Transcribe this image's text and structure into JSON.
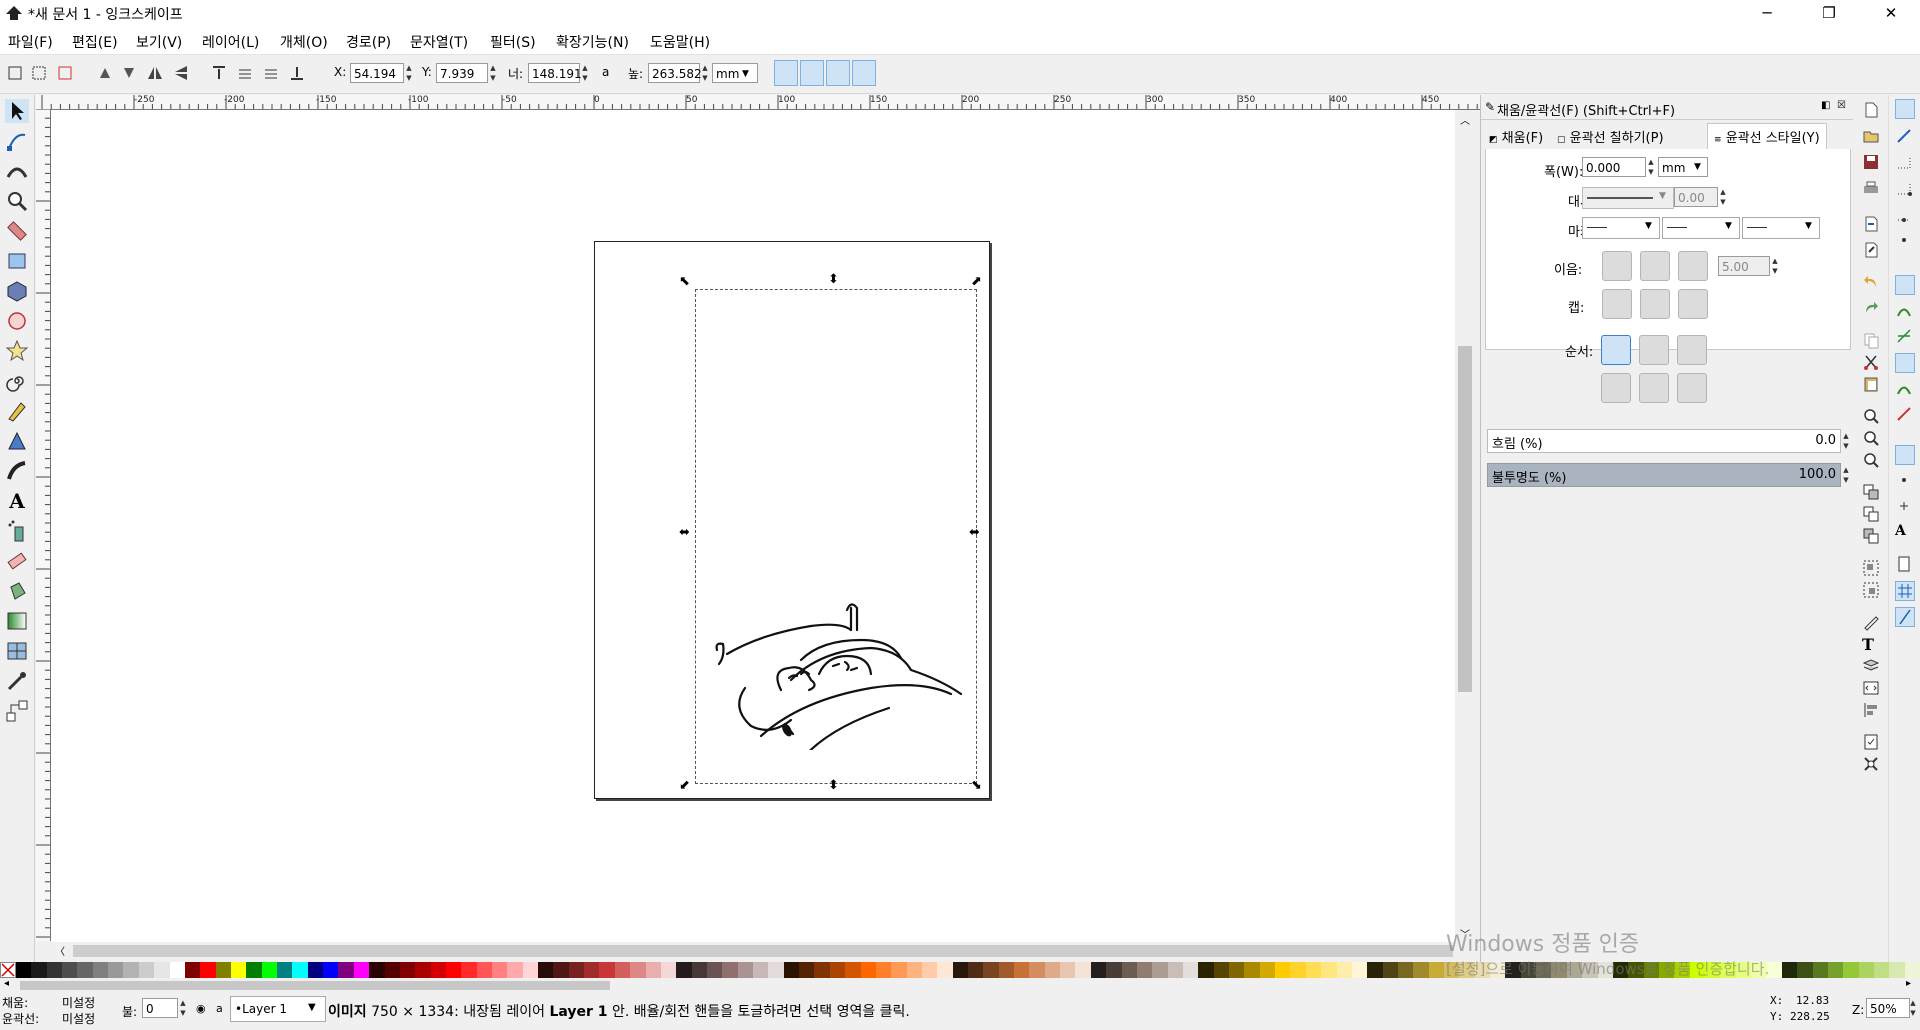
{
  "window": {
    "title": "*새 문서 1 - 잉크스케이프",
    "minimize": "─",
    "maximize": "❐",
    "close": "✕"
  },
  "menu": [
    "파일(F)",
    "편집(E)",
    "보기(V)",
    "레이어(L)",
    "개체(O)",
    "경로(P)",
    "문자열(T)",
    "필터(S)",
    "확장기능(N)",
    "도움말(H)"
  ],
  "toolbar": {
    "x_label": "X:",
    "x_value": "54.194",
    "y_label": "Y:",
    "y_value": "7.939",
    "w_label": "너:",
    "w_value": "148.191",
    "lock": "a",
    "h_label": "높:",
    "h_value": "263.582",
    "unit": "mm"
  },
  "ruler": {
    "h_ticks": [
      "-250",
      "-200",
      "-150",
      "-100",
      "-50",
      "0",
      "50",
      "100",
      "150",
      "200",
      "250",
      "300",
      "350",
      "400",
      "450"
    ],
    "v_ticks": [
      "5",
      "0",
      "5",
      "0",
      "5",
      "0",
      "5",
      "0",
      "5",
      "0",
      "5",
      "0",
      "5",
      "0",
      "5",
      "0",
      "5",
      "0",
      "5",
      "0",
      "0",
      "5",
      "0"
    ]
  },
  "dock": {
    "title": "채움/윤곽선(F) (Shift+Ctrl+F)",
    "tabs": [
      "채움(F)",
      "윤곽선 칠하기(P)",
      "윤곽선 스타일(Y)"
    ],
    "width_label": "폭(W):",
    "width_value": "0.000",
    "width_unit": "mm",
    "dash_label": "대시:",
    "dash_value": "0.00",
    "marker_label": "마커:",
    "join_label": "이음:",
    "join_value": "5.00",
    "cap_label": "캡:",
    "order_label": "순서:",
    "blur_label": "흐림 (%)",
    "blur_value": "0.0",
    "opacity_label": "불투명도 (%)",
    "opacity_value": "100.0",
    "opacity_level": 1.0
  },
  "watermark": {
    "line1": "Windows 정품 인증",
    "line2": "[설정]으로 이동하여 Windows를 정품 인증합니다."
  },
  "status": {
    "fill_label": "채움:",
    "fill_value": "미설정",
    "stroke_label": "윤곽선:",
    "stroke_value": "미설정",
    "opacity_label": "불:",
    "opacity_value": "0",
    "layer": "•Layer 1",
    "message_bold": "이미지",
    "message_a": "750 × 1334: 내장됨 레이어",
    "message_layer": "Layer 1",
    "message_b": "안. 배율/회전 핸들을 토글하려면 선택 영역을 클릭.",
    "x_label": "X:",
    "x_value": "12.83",
    "y_label": "Y:",
    "y_value": "228.25",
    "zoom_label": "Z:",
    "zoom_value": "50%"
  },
  "palette": [
    "#000000",
    "#1a1a1a",
    "#333333",
    "#4d4d4d",
    "#666666",
    "#808080",
    "#999999",
    "#b3b3b3",
    "#cccccc",
    "#e6e6e6",
    "#ffffff",
    "#800000",
    "#ff0000",
    "#808000",
    "#ffff00",
    "#008000",
    "#00ff00",
    "#008080",
    "#00ffff",
    "#000080",
    "#0000ff",
    "#800080",
    "#ff00ff",
    "#2b0000",
    "#550000",
    "#800000",
    "#aa0000",
    "#d40000",
    "#ff0000",
    "#ff2a2a",
    "#ff5555",
    "#ff8080",
    "#ffaaaa",
    "#ffd5d5",
    "#280b0b",
    "#501616",
    "#782121",
    "#a02c2c",
    "#c83737",
    "#d35f5f",
    "#de8787",
    "#e9afaf",
    "#f4d7d7",
    "#241c1c",
    "#483737",
    "#6c5353",
    "#916f6f",
    "#ac9393",
    "#c8b7b7",
    "#e3dbdb",
    "#2b1100",
    "#552200",
    "#803300",
    "#aa4400",
    "#d45500",
    "#ff6600",
    "#ff7f2a",
    "#ff9955",
    "#ffb380",
    "#ffccaa",
    "#ffe6d5",
    "#28170b",
    "#502d16",
    "#784421",
    "#a05a2c",
    "#c87137",
    "#d38d5f",
    "#deaa87",
    "#e9c6af",
    "#f4e3d7",
    "#241f1c",
    "#483e37",
    "#6c5d53",
    "#917c6f",
    "#ac9d93",
    "#c8beb7",
    "#e3dedb",
    "#2b2200",
    "#554400",
    "#806600",
    "#aa8800",
    "#d4aa00",
    "#ffcc00",
    "#ffd42a",
    "#ffdd55",
    "#ffe680",
    "#ffeeaa",
    "#fff6d5",
    "#28220b",
    "#504416",
    "#786721",
    "#a0892c",
    "#c8ab37",
    "#d3bc5f",
    "#decd87",
    "#e9ddaf",
    "#f4eed7",
    "#24221c",
    "#484537",
    "#6c6753",
    "#918a6f",
    "#aca793",
    "#c8c4b7",
    "#e3e2db",
    "#222b00",
    "#445500",
    "#668000",
    "#88aa00",
    "#aad400",
    "#ccff00",
    "#d4ff2a",
    "#ddff55",
    "#e5ff80",
    "#eeffaa",
    "#f6ffd5",
    "#1e280b",
    "#3c5016",
    "#597821",
    "#77a02c",
    "#94c837",
    "#abd35f",
    "#c1de87",
    "#d8e9af",
    "#eef4d7"
  ]
}
